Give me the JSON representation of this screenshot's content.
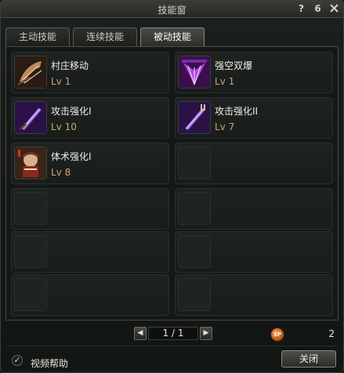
{
  "window": {
    "title": "技能窗",
    "help_icon": "?",
    "pin_icon": "6",
    "close_icon": "x"
  },
  "tabs": [
    {
      "label": "主动技能",
      "active": false
    },
    {
      "label": "连续技能",
      "active": false
    },
    {
      "label": "被动技能",
      "active": true
    }
  ],
  "skills": [
    {
      "name": "村庄移动",
      "level": "Lv 1",
      "icon": "boot-speed-icon"
    },
    {
      "name": "强空双爆",
      "level": "Lv 1",
      "icon": "purple-wing-icon"
    },
    {
      "name": "攻击强化I",
      "level": "Lv 10",
      "icon": "sword-attack-icon"
    },
    {
      "name": "攻击强化II",
      "level": "Lv 7",
      "icon": "sword-attack-icon"
    },
    {
      "name": "体术强化I",
      "level": "Lv 8",
      "icon": "fighter-portrait-icon"
    }
  ],
  "pager": {
    "prev_label": "◀",
    "text": "1 / 1",
    "next_label": "▶"
  },
  "sp": {
    "icon_label": "SP",
    "value": "2"
  },
  "footer": {
    "help_label": "视频帮助",
    "help_checked": true,
    "check_mark": "✓",
    "close_label": "关闭"
  },
  "colors": {
    "level_text": "#c9a96c",
    "sp_badge": "#c05a1e",
    "window_bg": "#151917"
  }
}
